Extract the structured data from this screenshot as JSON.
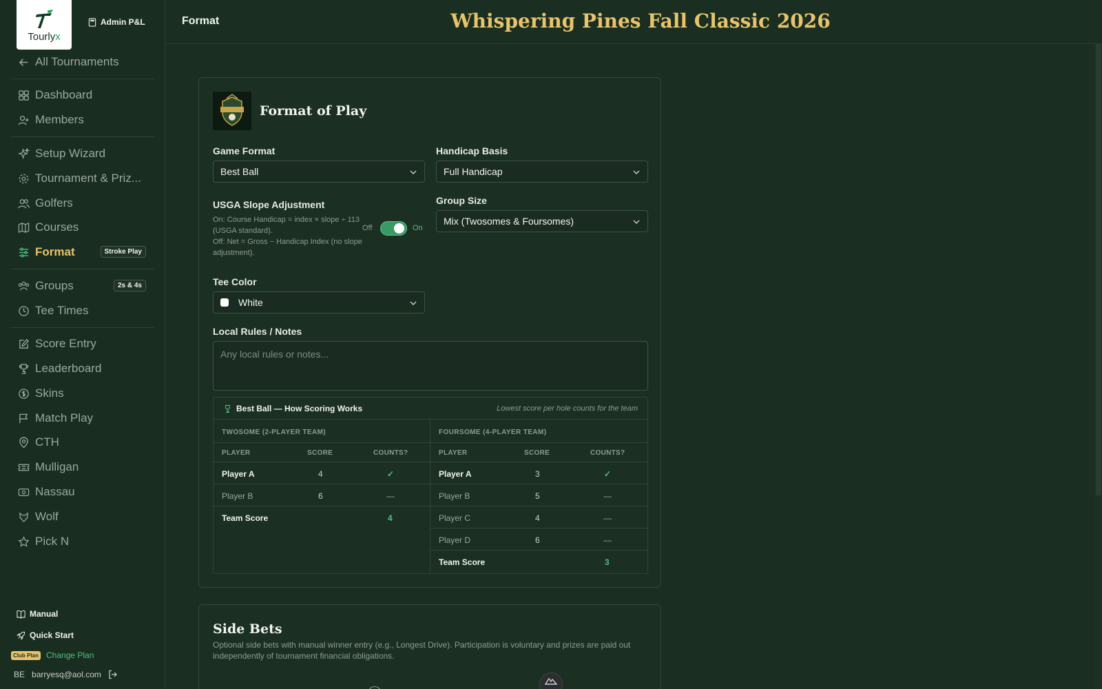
{
  "brand": {
    "name_main": "Tourly",
    "name_accent": "x"
  },
  "admin_label": "Admin P&L",
  "topbar": {
    "page_name": "Format",
    "tournament_title": "Whispering Pines Fall Classic 2026"
  },
  "nav": {
    "back": "All Tournaments",
    "dashboard": "Dashboard",
    "members": "Members",
    "setup_wizard": "Setup Wizard",
    "tournament_prizes": "Tournament & Priz...",
    "golfers": "Golfers",
    "courses": "Courses",
    "format": "Format",
    "format_badge": "Stroke Play",
    "groups": "Groups",
    "groups_badge": "2s & 4s",
    "tee_times": "Tee Times",
    "score_entry": "Score Entry",
    "leaderboard": "Leaderboard",
    "skins": "Skins",
    "match_play": "Match Play",
    "cth": "CTH",
    "mulligan": "Mulligan",
    "nassau": "Nassau",
    "wolf": "Wolf",
    "pick_n": "Pick N"
  },
  "footer": {
    "manual": "Manual",
    "quick_start": "Quick Start",
    "plan_badge": "Club Plan",
    "change_plan": "Change Plan",
    "user_initials": "BE",
    "user_email": "barryesq@aol.com"
  },
  "format_card": {
    "title": "Format of Play",
    "game_format_label": "Game Format",
    "game_format_value": "Best Ball",
    "handicap_label": "Handicap Basis",
    "handicap_value": "Full Handicap",
    "slope_label": "USGA Slope Adjustment",
    "slope_desc_on": "On: Course Handicap = index × slope ÷ 113 (USGA standard).",
    "slope_desc_off": "Off: Net = Gross − Handicap Index (no slope adjustment).",
    "toggle_off": "Off",
    "toggle_on": "On",
    "toggle_state": true,
    "group_size_label": "Group Size",
    "group_size_value": "Mix (Twosomes & Foursomes)",
    "tee_color_label": "Tee Color",
    "tee_color_value": "White",
    "tee_color_swatch": "#ffffff",
    "notes_label": "Local Rules / Notes",
    "notes_placeholder": "Any local rules or notes..."
  },
  "scoring": {
    "title": "Best Ball — How Scoring Works",
    "note": "Lowest score per hole counts for the team",
    "columns": {
      "player": "PLAYER",
      "score": "SCORE",
      "counts": "COUNTS?"
    },
    "twosome": {
      "title": "TWOSOME (2-PLAYER TEAM)",
      "rows": [
        {
          "player": "Player A",
          "score": "4",
          "counts": "✓"
        },
        {
          "player": "Player B",
          "score": "6",
          "counts": "—"
        }
      ],
      "team_label": "Team Score",
      "team_score": "4"
    },
    "foursome": {
      "title": "FOURSOME (4-PLAYER TEAM)",
      "rows": [
        {
          "player": "Player A",
          "score": "3",
          "counts": "✓"
        },
        {
          "player": "Player B",
          "score": "5",
          "counts": "—"
        },
        {
          "player": "Player C",
          "score": "4",
          "counts": "—"
        },
        {
          "player": "Player D",
          "score": "6",
          "counts": "—"
        }
      ],
      "team_label": "Team Score",
      "team_score": "3"
    }
  },
  "side_bets": {
    "title": "Side Bets",
    "desc": "Optional side bets with manual winner entry (e.g., Longest Drive). Participation is voluntary and prizes are paid out independently of tournament financial obligations."
  },
  "colors": {
    "accent_gold": "#e7c46b",
    "accent_green": "#4cc27e",
    "background": "#1b2e22"
  }
}
